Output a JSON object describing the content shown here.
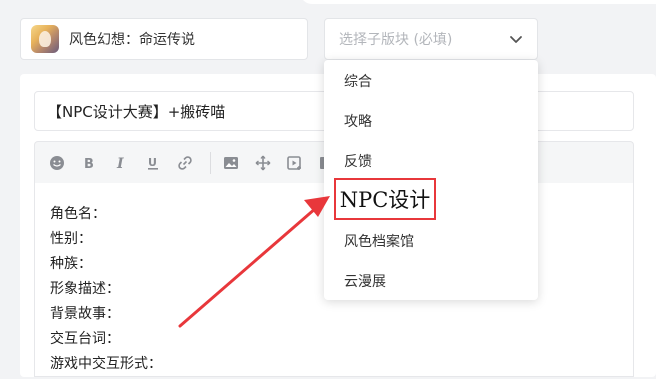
{
  "forum": {
    "name": "风色幻想：命运传说",
    "avatar": "game-avatar"
  },
  "subforum_select": {
    "placeholder": "选择子版块 (必填)",
    "icon": "chevron-down-icon"
  },
  "post": {
    "title": "【NPC设计大赛】+搬砖喵",
    "lines": [
      "角色名：",
      "性别：",
      "种族：",
      "形象描述：",
      "背景故事：",
      "交互台词：",
      "游戏中交互形式："
    ]
  },
  "toolbar": {
    "icons": [
      "emoji-icon",
      "bold-icon",
      "italic-icon",
      "underline-icon",
      "link-icon",
      "image-icon",
      "move-icon",
      "video-icon",
      "more-icon"
    ]
  },
  "dropdown": {
    "items": [
      "综合",
      "攻略",
      "反馈",
      "NPC设计",
      "风色档案馆",
      "云漫展"
    ],
    "highlighted": "NPC设计"
  },
  "colors": {
    "annotation_red": "#e8373b",
    "text": "#333333",
    "placeholder": "#b3b6bb"
  }
}
